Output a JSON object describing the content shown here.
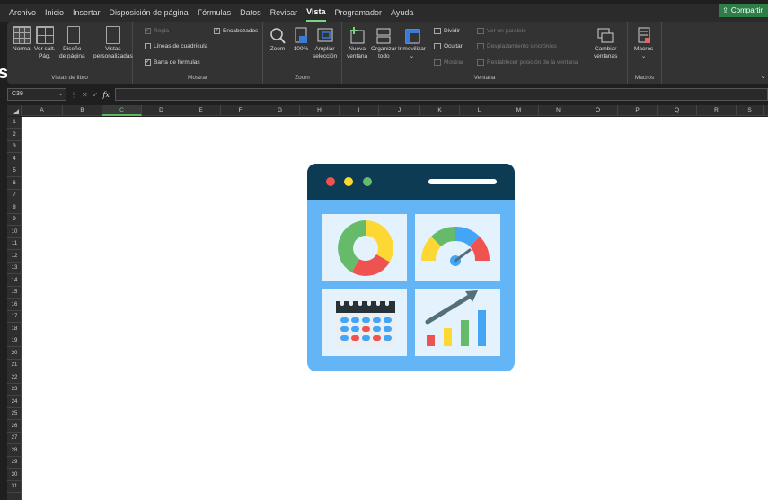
{
  "menu": {
    "tabs": [
      "Archivo",
      "Inicio",
      "Insertar",
      "Disposición de página",
      "Fórmulas",
      "Datos",
      "Revisar",
      "Vista",
      "Programador",
      "Ayuda"
    ],
    "active_tab": "Vista",
    "share_label": "Compartir"
  },
  "ribbon": {
    "vistas": {
      "label": "Vistas de libro",
      "normal": "Normal",
      "ver_salt": "Ver salt.\nPág.",
      "diseno": "Diseño\nde página",
      "vistas_pers": "Vistas\npersonalizadas"
    },
    "mostrar": {
      "label": "Mostrar",
      "regla": "Regla",
      "lineas": "Líneas de cuadrícula",
      "barra": "Barra de fórmulas",
      "encabezados": "Encabezados"
    },
    "zoom": {
      "label": "Zoom",
      "zoom": "Zoom",
      "cien": "100%",
      "ampliar": "Ampliar\nselección"
    },
    "ventana": {
      "label": "Ventana",
      "nueva": "Nueva\nventana",
      "organizar": "Organizar\ntodo",
      "inmovilizar": "Inmovilizar",
      "dividir": "Dividir",
      "ocultar": "Ocultar",
      "mostrar": "Mostrar",
      "paralelo": "Ver en paralelo",
      "desplazamiento": "Desplazamiento sincrónico",
      "restablecer": "Restablecer posición de la ventana",
      "cambiar": "Cambiar\nventanas"
    },
    "macros": {
      "label": "Macros",
      "macros": "Macros"
    }
  },
  "formula_bar": {
    "name_box": "C39",
    "fx": "fx",
    "value": ""
  },
  "grid": {
    "columns": [
      "A",
      "B",
      "C",
      "D",
      "E",
      "F",
      "G",
      "H",
      "I",
      "J",
      "K",
      "L",
      "M",
      "N",
      "O",
      "P",
      "Q",
      "R",
      "S"
    ],
    "active_column": "C",
    "rows": [
      "1",
      "2",
      "3",
      "4",
      "5",
      "6",
      "7",
      "8",
      "9",
      "10",
      "11",
      "12",
      "13",
      "14",
      "15",
      "16",
      "17",
      "18",
      "19",
      "20",
      "21",
      "22",
      "23",
      "24",
      "25",
      "26",
      "27",
      "28",
      "29",
      "30",
      "31"
    ]
  },
  "colors": {
    "accent": "#7dd37d",
    "share": "#2d7d46",
    "illus_frame": "#64b5f6",
    "illus_header": "#0d3b54",
    "panel_bg": "#e3f2fd"
  }
}
